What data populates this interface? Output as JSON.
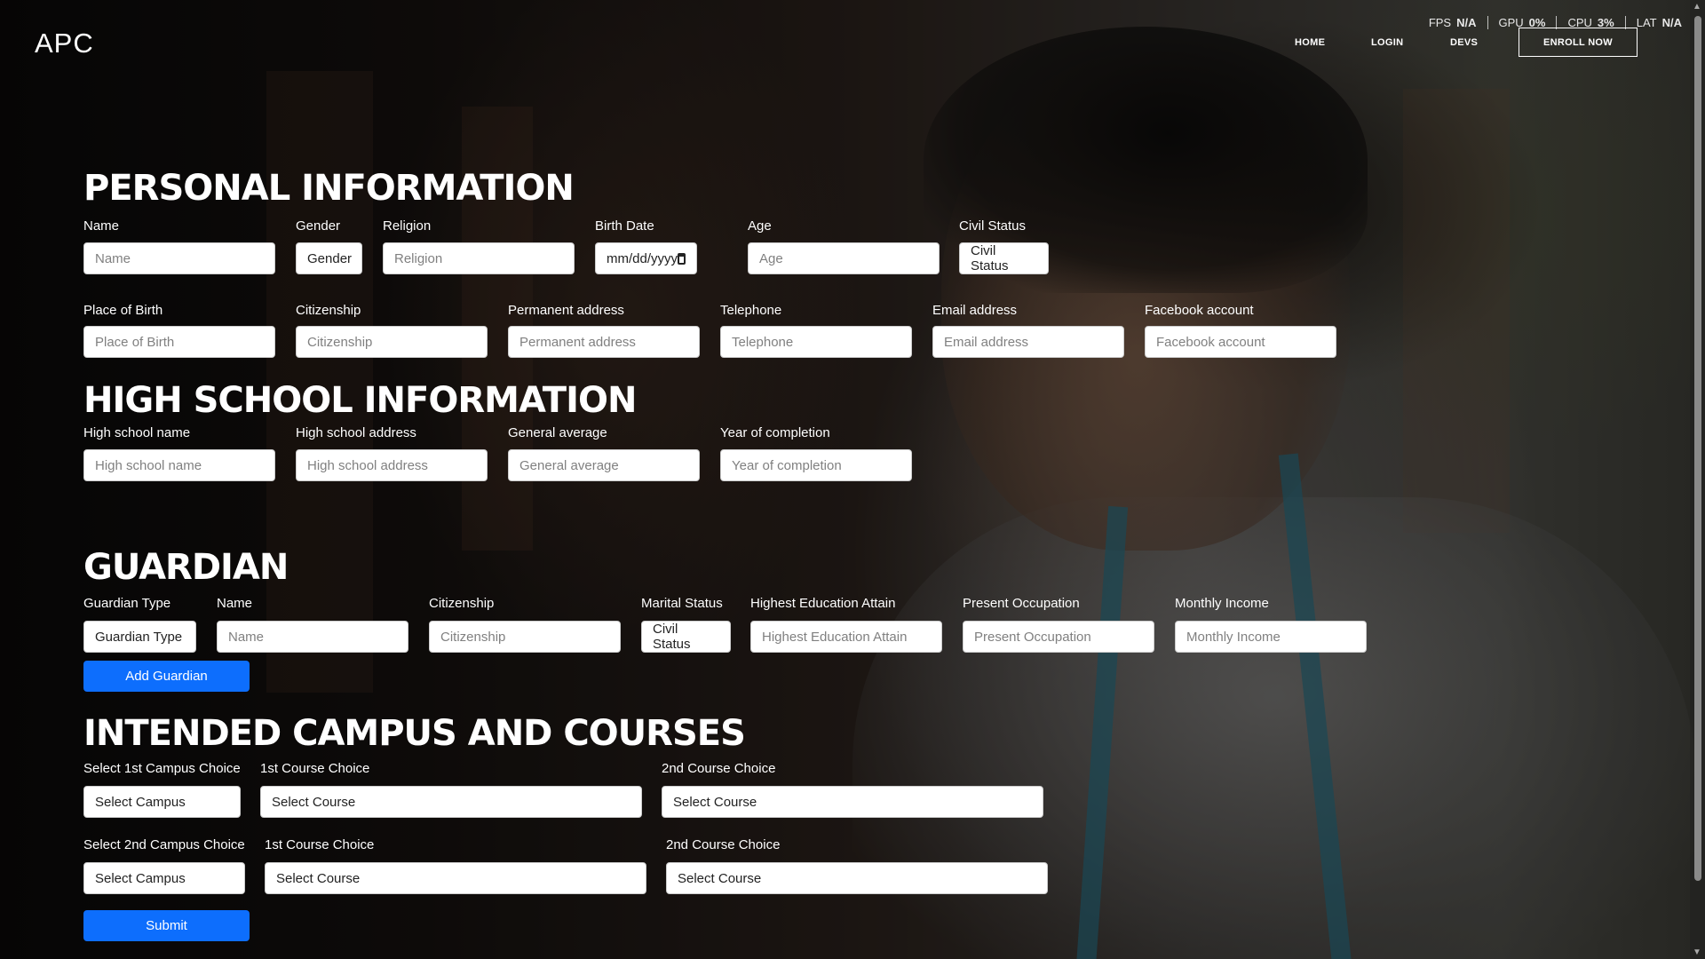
{
  "header": {
    "logo": "APC",
    "nav": {
      "home": "HOME",
      "login": "LOGIN",
      "devs": "DEVS",
      "enroll": "ENROLL NOW"
    },
    "perf": [
      {
        "label": "FPS",
        "value": "N/A"
      },
      {
        "label": "GPU",
        "value": "0%"
      },
      {
        "label": "CPU",
        "value": "3%"
      },
      {
        "label": "LAT",
        "value": "N/A"
      }
    ]
  },
  "personal": {
    "title": "PERSONAL INFORMATION",
    "name": {
      "label": "Name",
      "placeholder": "Name"
    },
    "gender": {
      "label": "Gender",
      "value": "Gender"
    },
    "religion": {
      "label": "Religion",
      "placeholder": "Religion"
    },
    "birth_date": {
      "label": "Birth Date",
      "placeholder": "mm/dd/yyyy"
    },
    "age": {
      "label": "Age",
      "placeholder": "Age"
    },
    "civil_status": {
      "label": "Civil Status",
      "value": "Civil Status"
    },
    "place_of_birth": {
      "label": "Place of Birth",
      "placeholder": "Place of Birth"
    },
    "citizenship": {
      "label": "Citizenship",
      "placeholder": "Citizenship"
    },
    "permanent_address": {
      "label": "Permanent address",
      "placeholder": "Permanent address"
    },
    "telephone": {
      "label": "Telephone",
      "placeholder": "Telephone"
    },
    "email": {
      "label": "Email address",
      "placeholder": "Email address"
    },
    "facebook": {
      "label": "Facebook account",
      "placeholder": "Facebook account"
    }
  },
  "high_school": {
    "title": "HIGH SCHOOL INFORMATION",
    "name": {
      "label": "High school name",
      "placeholder": "High school name"
    },
    "address": {
      "label": "High school address",
      "placeholder": "High school address"
    },
    "average": {
      "label": "General average",
      "placeholder": "General average"
    },
    "year": {
      "label": "Year of completion",
      "placeholder": "Year of completion"
    }
  },
  "guardian": {
    "title": "GUARDIAN",
    "type": {
      "label": "Guardian Type",
      "value": "Guardian Type"
    },
    "name": {
      "label": "Name",
      "placeholder": "Name"
    },
    "citizenship": {
      "label": "Citizenship",
      "placeholder": "Citizenship"
    },
    "marital_status": {
      "label": "Marital Status",
      "value": "Civil Status"
    },
    "education": {
      "label": "Highest Education Attain",
      "placeholder": "Highest Education Attain"
    },
    "occupation": {
      "label": "Present Occupation",
      "placeholder": "Present Occupation"
    },
    "income": {
      "label": "Monthly Income",
      "placeholder": "Monthly Income"
    },
    "add_button": "Add Guardian"
  },
  "courses": {
    "title": "INTENDED CAMPUS AND COURSES",
    "row1": {
      "campus": {
        "label": "Select 1st Campus Choice",
        "value": "Select Campus"
      },
      "course1": {
        "label": "1st Course Choice",
        "value": "Select Course"
      },
      "course2": {
        "label": "2nd Course Choice",
        "value": "Select Course"
      }
    },
    "row2": {
      "campus": {
        "label": "Select 2nd Campus Choice",
        "value": "Select Campus"
      },
      "course1": {
        "label": "1st Course Choice",
        "value": "Select Course"
      },
      "course2": {
        "label": "2nd Course Choice",
        "value": "Select Course"
      }
    },
    "submit": "Submit"
  },
  "colors": {
    "primary_button": "#0d6efd",
    "background": "#0d0d0d"
  }
}
